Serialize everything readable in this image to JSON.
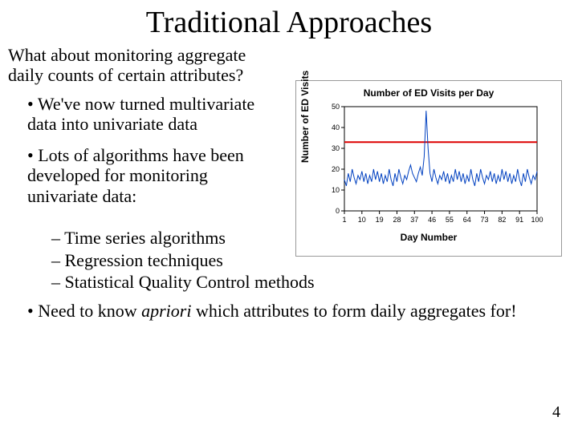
{
  "title": "Traditional Approaches",
  "intro": "What about monitoring aggregate daily counts of certain attributes?",
  "bullets": {
    "b1": "We've now turned multivariate data into univariate data",
    "b2": "Lots of algorithms have been developed for monitoring univariate data:"
  },
  "sub": {
    "s1": "Time series algorithms",
    "s2": "Regression techniques",
    "s3": "Statistical Quality Control methods"
  },
  "final_pre": "Need to know ",
  "final_em": "apriori",
  "final_post": " which attributes to form daily aggregates for!",
  "pagenum": "4",
  "chart_data": {
    "type": "line",
    "title": "Number of ED Visits per Day",
    "xlabel": "Day Number",
    "ylabel": "Number of ED Visits",
    "ylim": [
      0,
      50
    ],
    "yticks": [
      0,
      10,
      20,
      30,
      40,
      50
    ],
    "xlim": [
      1,
      100
    ],
    "xticks": [
      1,
      10,
      19,
      28,
      37,
      46,
      55,
      64,
      73,
      82,
      91,
      100
    ],
    "threshold": 33,
    "x": [
      1,
      2,
      3,
      4,
      5,
      6,
      7,
      8,
      9,
      10,
      11,
      12,
      13,
      14,
      15,
      16,
      17,
      18,
      19,
      20,
      21,
      22,
      23,
      24,
      25,
      26,
      27,
      28,
      29,
      30,
      31,
      32,
      33,
      34,
      35,
      36,
      37,
      38,
      39,
      40,
      41,
      42,
      43,
      44,
      45,
      46,
      47,
      48,
      49,
      50,
      51,
      52,
      53,
      54,
      55,
      56,
      57,
      58,
      59,
      60,
      61,
      62,
      63,
      64,
      65,
      66,
      67,
      68,
      69,
      70,
      71,
      72,
      73,
      74,
      75,
      76,
      77,
      78,
      79,
      80,
      81,
      82,
      83,
      84,
      85,
      86,
      87,
      88,
      89,
      90,
      91,
      92,
      93,
      94,
      95,
      96,
      97,
      98,
      99,
      100
    ],
    "values": [
      15,
      12,
      18,
      14,
      20,
      16,
      13,
      17,
      15,
      19,
      14,
      18,
      13,
      17,
      14,
      20,
      15,
      19,
      14,
      18,
      13,
      17,
      14,
      20,
      15,
      12,
      18,
      14,
      20,
      16,
      13,
      17,
      15,
      19,
      22,
      18,
      16,
      14,
      18,
      21,
      17,
      26,
      48,
      30,
      18,
      14,
      20,
      16,
      13,
      17,
      15,
      19,
      14,
      18,
      13,
      17,
      14,
      20,
      15,
      19,
      14,
      18,
      13,
      17,
      14,
      20,
      15,
      12,
      18,
      14,
      20,
      16,
      13,
      17,
      15,
      19,
      14,
      18,
      13,
      17,
      14,
      20,
      15,
      19,
      14,
      18,
      13,
      17,
      14,
      20,
      15,
      12,
      18,
      14,
      20,
      16,
      13,
      17,
      15,
      19
    ]
  }
}
